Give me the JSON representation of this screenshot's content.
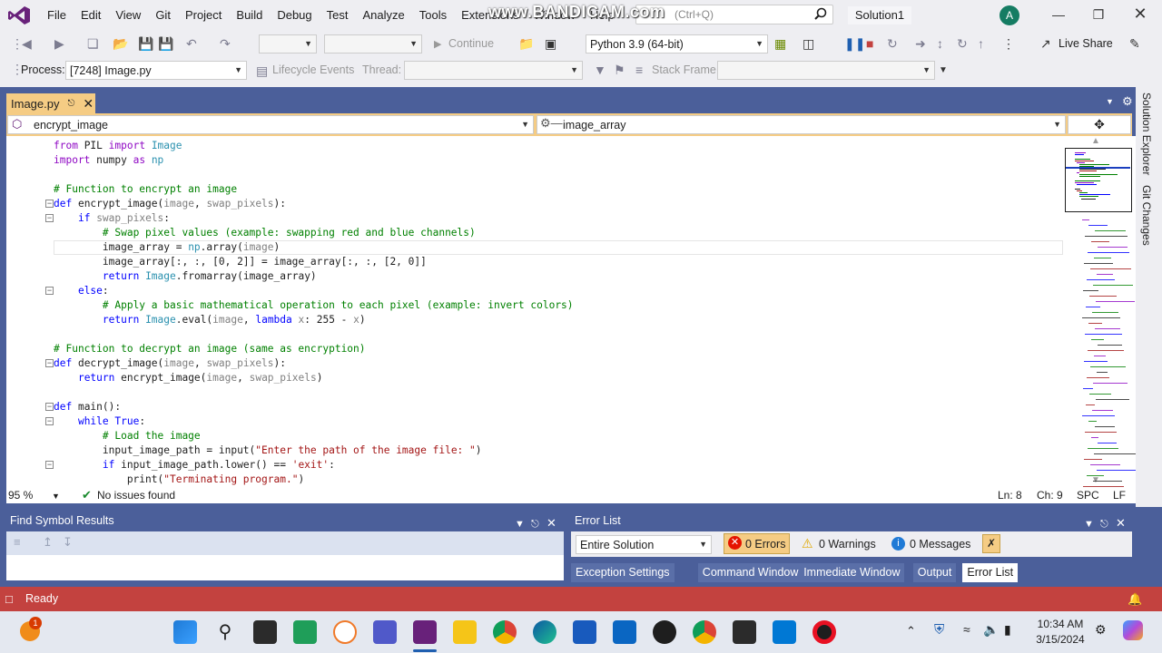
{
  "menubar": {
    "items": [
      "File",
      "Edit",
      "View",
      "Git",
      "Project",
      "Build",
      "Debug",
      "Test",
      "Analyze",
      "Tools",
      "Extensions",
      "Window",
      "Help"
    ],
    "watermark": "www.BANDICAM.com",
    "search_placeholder": "(Ctrl+Q)",
    "solution_title": "Solution1",
    "avatar_initial": "A"
  },
  "toolbar": {
    "continue_label": "Continue",
    "python_env": "Python 3.9 (64-bit)",
    "live_share_label": "Live Share",
    "process_label": "Process:",
    "process_value": "[7248] Image.py",
    "lifecycle_label": "Lifecycle Events",
    "thread_label": "Thread:",
    "stack_frame_label": "Stack Frame:"
  },
  "side_tabs": [
    "Solution Explorer",
    "Git Changes"
  ],
  "document": {
    "tab_name": "Image.py",
    "nav_scope": "encrypt_image",
    "nav_member": "image_array"
  },
  "code_lines": [
    {
      "text": "from PIL import Image"
    },
    {
      "text": "import numpy as np"
    },
    {
      "text": ""
    },
    {
      "text": "# Function to encrypt an image"
    },
    {
      "text": "def encrypt_image(image, swap_pixels):"
    },
    {
      "text": "    if swap_pixels:"
    },
    {
      "text": "        # Swap pixel values (example: swapping red and blue channels)"
    },
    {
      "text": "        image_array = np.array(image)"
    },
    {
      "text": "        image_array[:, :, [0, 2]] = image_array[:, :, [2, 0]]"
    },
    {
      "text": "        return Image.fromarray(image_array)"
    },
    {
      "text": "    else:"
    },
    {
      "text": "        # Apply a basic mathematical operation to each pixel (example: invert colors)"
    },
    {
      "text": "        return Image.eval(image, lambda x: 255 - x)"
    },
    {
      "text": ""
    },
    {
      "text": "# Function to decrypt an image (same as encryption)"
    },
    {
      "text": "def decrypt_image(image, swap_pixels):"
    },
    {
      "text": "    return encrypt_image(image, swap_pixels)"
    },
    {
      "text": ""
    },
    {
      "text": "def main():"
    },
    {
      "text": "    while True:"
    },
    {
      "text": "        # Load the image"
    },
    {
      "text": "        input_image_path = input(\"Enter the path of the image file: \")"
    },
    {
      "text": "        if input_image_path.lower() == 'exit':"
    },
    {
      "text": "            print(\"Terminating program.\")"
    }
  ],
  "editor_status": {
    "zoom": "95 %",
    "issues": "No issues found",
    "line": "Ln: 8",
    "col": "Ch: 9",
    "spc": "SPC",
    "lf": "LF"
  },
  "find_symbol": {
    "title": "Find Symbol Results"
  },
  "error_list": {
    "title": "Error List",
    "scope": "Entire Solution",
    "errors": "0 Errors",
    "warnings": "0 Warnings",
    "messages": "0 Messages"
  },
  "bottom_tabs": [
    "Exception Settings",
    "Command Window",
    "Immediate Window",
    "Output",
    "Error List"
  ],
  "status": {
    "ready": "Ready"
  },
  "taskbar": {
    "badge_count": "1",
    "time": "10:34 AM",
    "date": "3/15/2024"
  },
  "colors": {
    "accent_tab": "#f5cc84",
    "frame_blue": "#4b5f9a",
    "status_red": "#c3423f",
    "vs_purple": "#68217a"
  }
}
